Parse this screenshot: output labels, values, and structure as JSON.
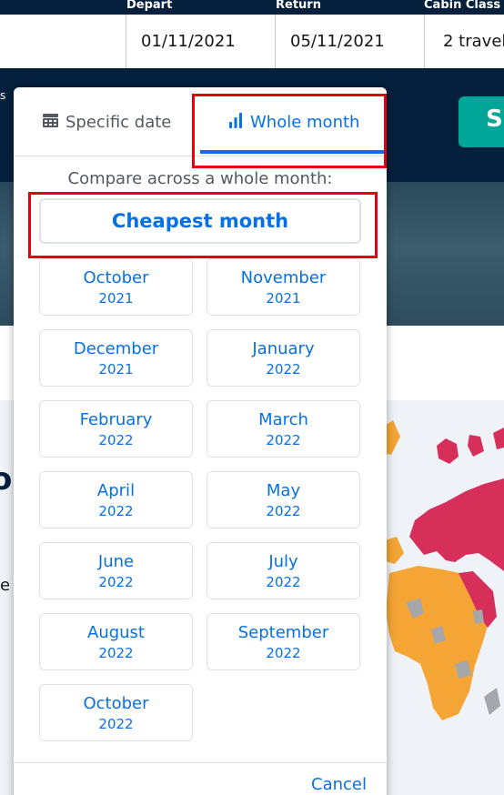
{
  "search_bar": {
    "labels": {
      "depart": "Depart",
      "return": "Return",
      "cabin": "Cabin Class &"
    },
    "depart_value": "01/11/2021",
    "return_value": "05/11/2021",
    "cabin_value": "2 travel",
    "search_button_label": "S"
  },
  "page_fragments": {
    "left_s": "s",
    "left_o": "o",
    "left_e": "e"
  },
  "date_picker": {
    "tabs": {
      "specific": "Specific date",
      "whole": "Whole month"
    },
    "compare_text": "Compare across a whole month:",
    "cheapest_label": "Cheapest month",
    "months": [
      {
        "month": "October",
        "year": "2021"
      },
      {
        "month": "November",
        "year": "2021"
      },
      {
        "month": "December",
        "year": "2021"
      },
      {
        "month": "January",
        "year": "2022"
      },
      {
        "month": "February",
        "year": "2022"
      },
      {
        "month": "March",
        "year": "2022"
      },
      {
        "month": "April",
        "year": "2022"
      },
      {
        "month": "May",
        "year": "2022"
      },
      {
        "month": "June",
        "year": "2022"
      },
      {
        "month": "July",
        "year": "2022"
      },
      {
        "month": "August",
        "year": "2022"
      },
      {
        "month": "September",
        "year": "2022"
      },
      {
        "month": "October",
        "year": "2022"
      }
    ],
    "cancel_label": "Cancel"
  },
  "colors": {
    "accent": "#0770e3",
    "highlight": "#e4000f",
    "header_bg": "#05203c",
    "search_button": "#00a698"
  }
}
